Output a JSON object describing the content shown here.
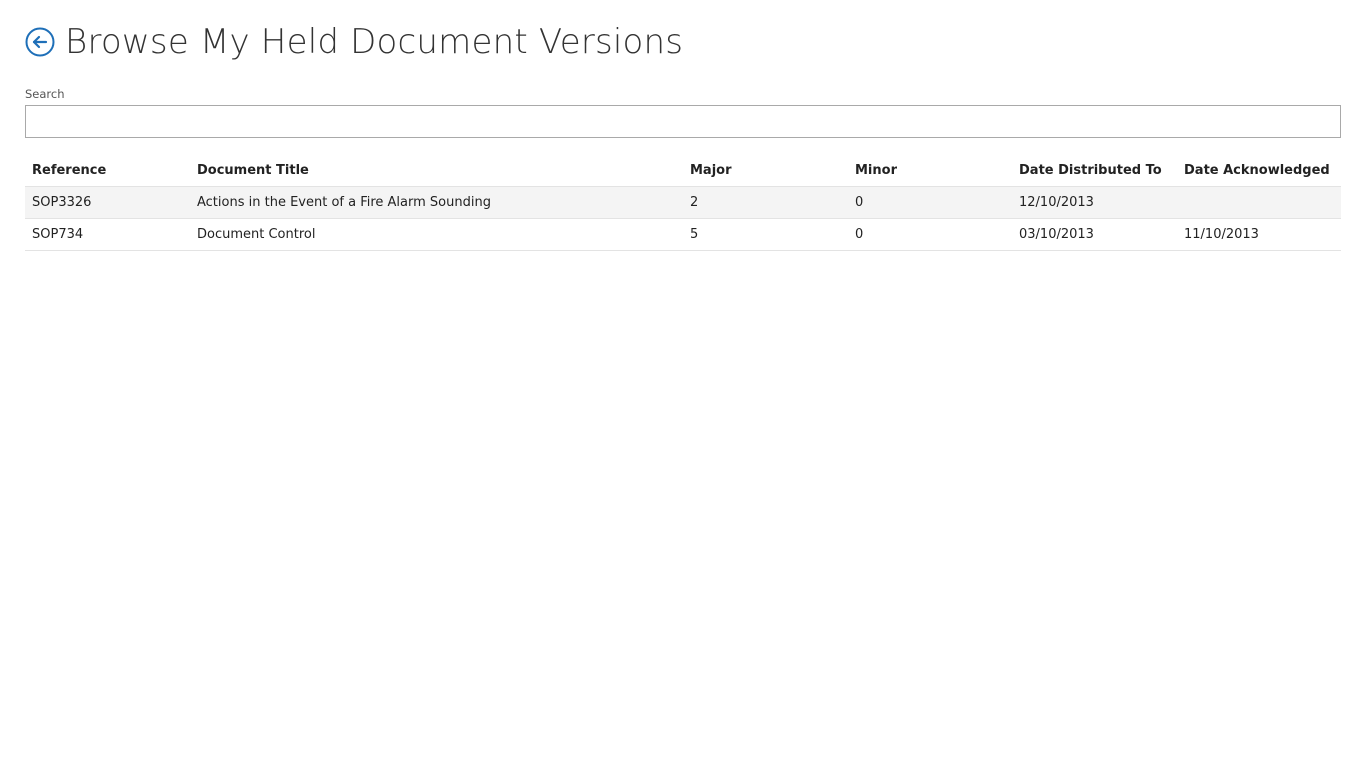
{
  "header": {
    "title": "Browse My Held Document Versions",
    "back_icon": "back-arrow-circle-icon",
    "accent": "#1e6fb8"
  },
  "search": {
    "label": "Search",
    "value": "",
    "placeholder": ""
  },
  "table": {
    "columns": [
      "Reference",
      "Document Title",
      "Major",
      "Minor",
      "Date Distributed To",
      "Date Acknowledged"
    ],
    "rows": [
      {
        "reference": "SOP3326",
        "title": "Actions in the Event of a Fire Alarm Sounding",
        "major": "2",
        "minor": "0",
        "date_distributed": "12/10/2013",
        "date_acknowledged": ""
      },
      {
        "reference": "SOP734",
        "title": "Document Control",
        "major": "5",
        "minor": "0",
        "date_distributed": "03/10/2013",
        "date_acknowledged": "11/10/2013"
      }
    ]
  }
}
